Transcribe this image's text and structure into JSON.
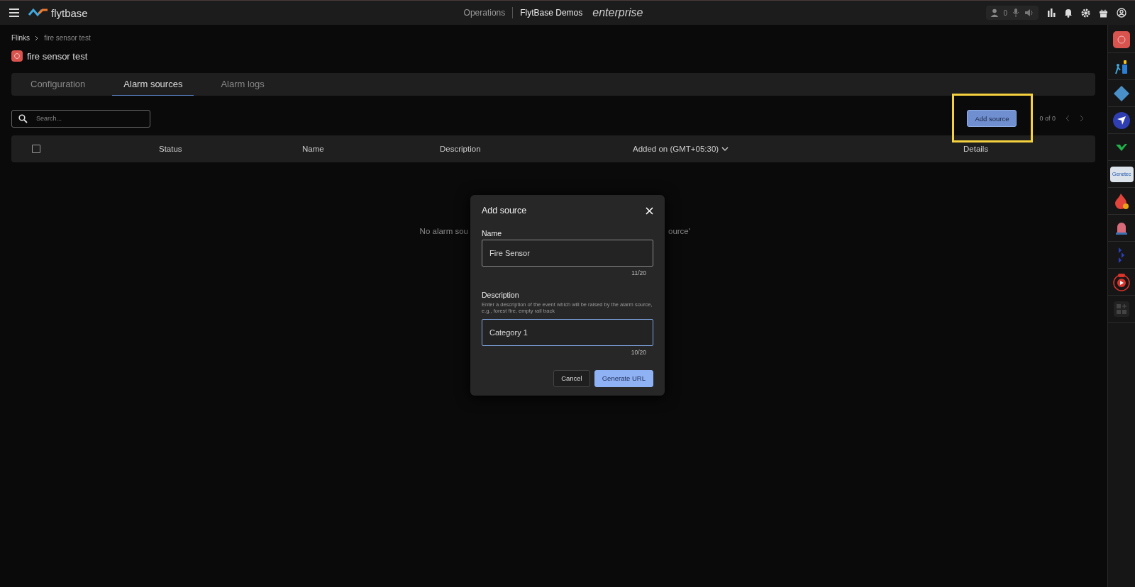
{
  "top_bar": {
    "logo": "flytbase",
    "nav": "Operations",
    "org": "FlytBase Demos",
    "edition": "enterprise",
    "user_count": "0"
  },
  "breadcrumb": [
    "Flinks",
    "fire sensor test"
  ],
  "page_title": "fire sensor test",
  "tabs": [
    {
      "label": "Configuration",
      "selected": false
    },
    {
      "label": "Alarm sources",
      "selected": true
    },
    {
      "label": "Alarm logs",
      "selected": false
    }
  ],
  "search": {
    "placeholder": "Search..."
  },
  "toolbar": {
    "add_button": "Add source",
    "highlighted": true,
    "pagination": "0 of 0"
  },
  "table": {
    "select_all_checked": false,
    "columns": [
      "Status",
      "Name",
      "Description",
      "Added on (GMT+05:30)",
      "Details"
    ],
    "empty_message_parts": [
      "No alarm sou",
      "ource'"
    ]
  },
  "dialog": {
    "title": "Add source",
    "fields": [
      {
        "label": "Name",
        "value": "Fire Sensor",
        "counter": "11/20",
        "focused": false
      },
      {
        "label": "Description",
        "help": "Enter a description of the event which will be raised by the alarm source, e.g., forest fire, empty rail track",
        "value": "Category 1",
        "counter": "10/20",
        "focused": true
      }
    ],
    "buttons": [
      {
        "label": "Cancel",
        "kind": "secondary"
      },
      {
        "label": "Generate URL",
        "kind": "primary"
      }
    ]
  },
  "sidebar": {
    "vendor_label": "Genetec"
  }
}
